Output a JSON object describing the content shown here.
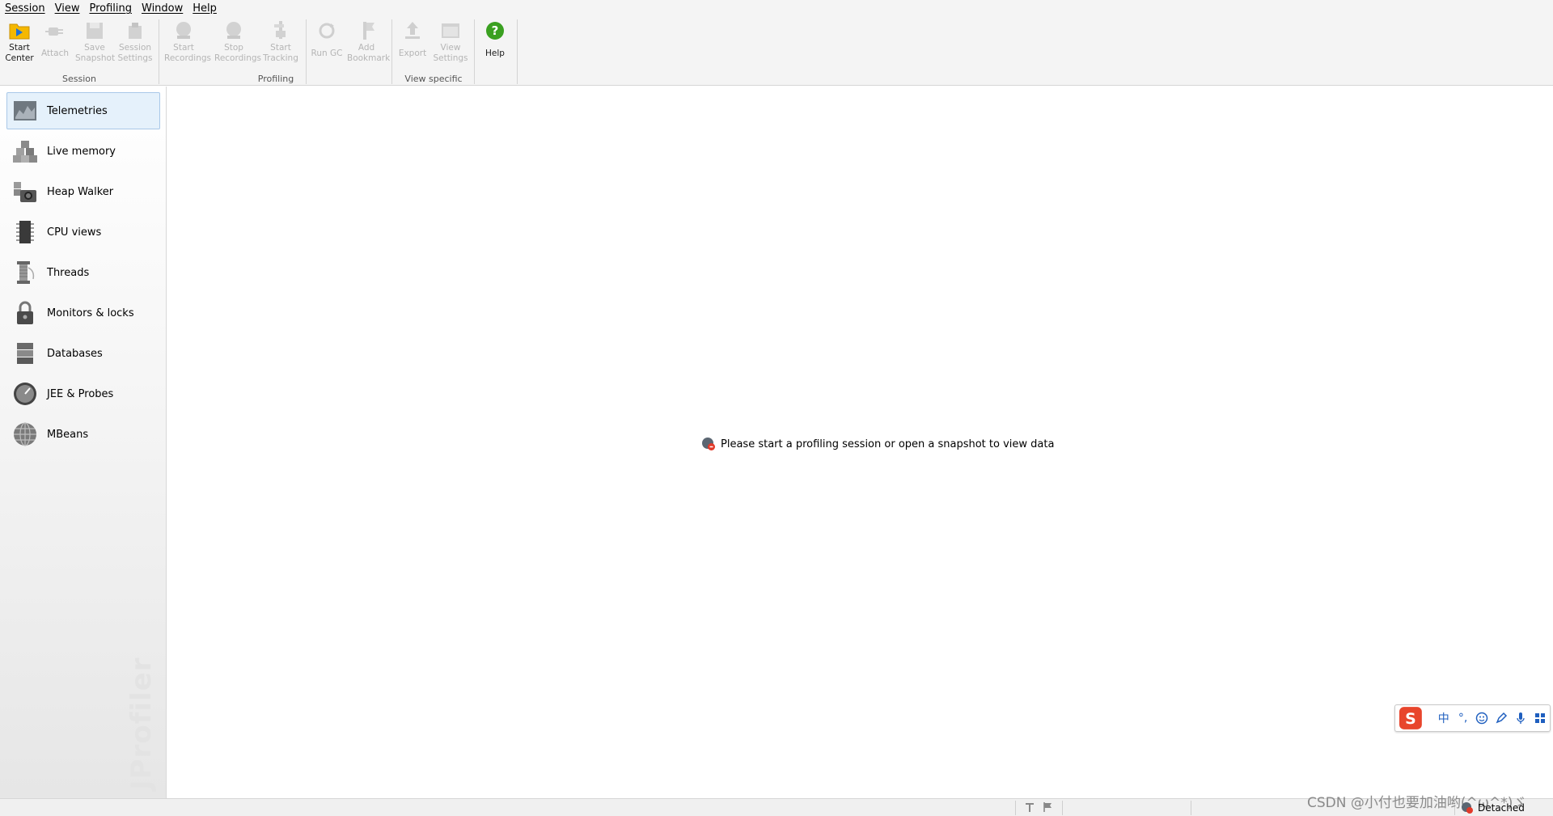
{
  "menu": [
    "Session",
    "View",
    "Profiling",
    "Window",
    "Help"
  ],
  "toolbar": {
    "groups": {
      "session": "Session",
      "profiling": "Profiling",
      "view_specific": "View specific"
    },
    "buttons": {
      "start_center": "Start\nCenter",
      "attach": "Attach",
      "save_snapshot": "Save\nSnapshot",
      "session_settings": "Session\nSettings",
      "start_recordings": "Start\nRecordings",
      "stop_recordings": "Stop\nRecordings",
      "start_tracking": "Start\nTracking",
      "run_gc": "Run GC",
      "add_bookmark": "Add\nBookmark",
      "export": "Export",
      "view_settings": "View\nSettings",
      "help": "Help"
    }
  },
  "sidebar": {
    "items": [
      {
        "label": "Telemetries",
        "icon": "telemetries-icon",
        "active": true
      },
      {
        "label": "Live memory",
        "icon": "live-memory-icon"
      },
      {
        "label": "Heap Walker",
        "icon": "heap-walker-icon"
      },
      {
        "label": "CPU views",
        "icon": "cpu-views-icon"
      },
      {
        "label": "Threads",
        "icon": "threads-icon"
      },
      {
        "label": "Monitors & locks",
        "icon": "monitors-locks-icon"
      },
      {
        "label": "Databases",
        "icon": "databases-icon"
      },
      {
        "label": "JEE & Probes",
        "icon": "jee-probes-icon"
      },
      {
        "label": "MBeans",
        "icon": "mbeans-icon"
      }
    ],
    "brand": "JProfiler"
  },
  "main": {
    "message": "Please start a profiling session or open a snapshot to view data"
  },
  "ime": {
    "chinese_mode": "中",
    "punctuation": "°,"
  },
  "statusbar": {
    "status": "Detached"
  },
  "watermark": "CSDN @小付也要加油哟(^ω^*)ゞ",
  "colors": {
    "accent_selection": "#e5f1fb",
    "selection_border": "#a9c8e8",
    "help_green": "#3aa020",
    "start_center_yellow": "#f5b800",
    "ime_red": "#e8452c"
  }
}
